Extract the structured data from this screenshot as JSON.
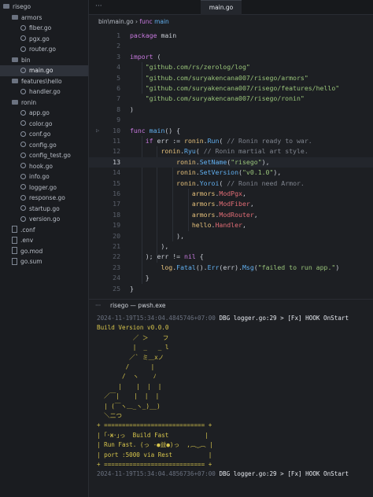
{
  "sidebar": {
    "items": [
      {
        "label": "risego",
        "type": "folder",
        "depth": 0
      },
      {
        "label": "armors",
        "type": "folder",
        "depth": 1
      },
      {
        "label": "fiber.go",
        "type": "file",
        "depth": 2
      },
      {
        "label": "pgx.go",
        "type": "file",
        "depth": 2
      },
      {
        "label": "router.go",
        "type": "file",
        "depth": 2
      },
      {
        "label": "bin",
        "type": "folder",
        "depth": 1
      },
      {
        "label": "main.go",
        "type": "file",
        "depth": 2,
        "selected": true
      },
      {
        "label": "features\\hello",
        "type": "folder",
        "depth": 1
      },
      {
        "label": "handler.go",
        "type": "file",
        "depth": 2
      },
      {
        "label": "ronin",
        "type": "folder",
        "depth": 1
      },
      {
        "label": "app.go",
        "type": "file",
        "depth": 2
      },
      {
        "label": "color.go",
        "type": "file",
        "depth": 2
      },
      {
        "label": "conf.go",
        "type": "file",
        "depth": 2
      },
      {
        "label": "config.go",
        "type": "file",
        "depth": 2
      },
      {
        "label": "config_test.go",
        "type": "file",
        "depth": 2
      },
      {
        "label": "hook.go",
        "type": "file",
        "depth": 2
      },
      {
        "label": "info.go",
        "type": "file",
        "depth": 2
      },
      {
        "label": "logger.go",
        "type": "file",
        "depth": 2
      },
      {
        "label": "response.go",
        "type": "file",
        "depth": 2
      },
      {
        "label": "startup.go",
        "type": "file",
        "depth": 2
      },
      {
        "label": "version.go",
        "type": "file",
        "depth": 2
      },
      {
        "label": ".conf",
        "type": "file",
        "depth": 1
      },
      {
        "label": ".env",
        "type": "file",
        "depth": 1
      },
      {
        "label": "go.mod",
        "type": "file",
        "depth": 1
      },
      {
        "label": "go.sum",
        "type": "file",
        "depth": 1
      }
    ]
  },
  "tabbar": {
    "ellipsis": "···",
    "active_tab": "main.go"
  },
  "breadcrumb": {
    "path": "bin\\main.go",
    "sep": "›",
    "func_kw": "func",
    "func_name": "main"
  },
  "editor": {
    "current_line": 13,
    "lines": [
      {
        "n": "1",
        "tokens": [
          [
            "kw",
            "package"
          ],
          [
            "punc",
            " main"
          ]
        ]
      },
      {
        "n": "2",
        "tokens": []
      },
      {
        "n": "3",
        "tokens": [
          [
            "kw",
            "import"
          ],
          [
            "punc",
            " ("
          ]
        ]
      },
      {
        "n": "4",
        "tokens": [
          [
            "punc",
            "    "
          ],
          [
            "str",
            "\"github.com/rs/zerolog/log\""
          ]
        ]
      },
      {
        "n": "5",
        "tokens": [
          [
            "punc",
            "    "
          ],
          [
            "str",
            "\"github.com/suryakencana007/risego/armors\""
          ]
        ]
      },
      {
        "n": "6",
        "tokens": [
          [
            "punc",
            "    "
          ],
          [
            "str",
            "\"github.com/suryakencana007/risego/features/hello\""
          ]
        ]
      },
      {
        "n": "7",
        "tokens": [
          [
            "punc",
            "    "
          ],
          [
            "str",
            "\"github.com/suryakencana007/risego/ronin\""
          ]
        ]
      },
      {
        "n": "8",
        "tokens": [
          [
            "punc",
            ")"
          ]
        ]
      },
      {
        "n": "9",
        "tokens": []
      },
      {
        "n": "10",
        "fold": true,
        "tokens": [
          [
            "kw",
            "func"
          ],
          [
            "punc",
            " "
          ],
          [
            "fn",
            "main"
          ],
          [
            "punc",
            "() {"
          ]
        ]
      },
      {
        "n": "11",
        "tokens": [
          [
            "punc",
            "    "
          ],
          [
            "kw",
            "if"
          ],
          [
            "punc",
            " err := "
          ],
          [
            "var",
            "ronin"
          ],
          [
            "punc",
            "."
          ],
          [
            "fn",
            "Run"
          ],
          [
            "punc",
            "( "
          ],
          [
            "cmt",
            "// Ronin ready to war."
          ]
        ]
      },
      {
        "n": "12",
        "tokens": [
          [
            "punc",
            "        "
          ],
          [
            "var",
            "ronin"
          ],
          [
            "punc",
            "."
          ],
          [
            "fn",
            "Ryu"
          ],
          [
            "punc",
            "( "
          ],
          [
            "cmt",
            "// Ronin martial art style."
          ]
        ]
      },
      {
        "n": "13",
        "tokens": [
          [
            "punc",
            "            "
          ],
          [
            "var",
            "ronin"
          ],
          [
            "punc",
            "."
          ],
          [
            "fn",
            "SetName"
          ],
          [
            "punc",
            "("
          ],
          [
            "str",
            "\"risego\""
          ],
          [
            "punc",
            "),"
          ]
        ]
      },
      {
        "n": "14",
        "tokens": [
          [
            "punc",
            "            "
          ],
          [
            "var",
            "ronin"
          ],
          [
            "punc",
            "."
          ],
          [
            "fn",
            "SetVersion"
          ],
          [
            "punc",
            "("
          ],
          [
            "str",
            "\"v0.1.0\""
          ],
          [
            "punc",
            "),"
          ]
        ]
      },
      {
        "n": "15",
        "tokens": [
          [
            "punc",
            "            "
          ],
          [
            "var",
            "ronin"
          ],
          [
            "punc",
            "."
          ],
          [
            "fn",
            "Yoroi"
          ],
          [
            "punc",
            "( "
          ],
          [
            "cmt",
            "// Ronin need Armor."
          ]
        ]
      },
      {
        "n": "16",
        "tokens": [
          [
            "punc",
            "                "
          ],
          [
            "var",
            "armors"
          ],
          [
            "punc",
            "."
          ],
          [
            "fld",
            "ModPgx"
          ],
          [
            "punc",
            ","
          ]
        ]
      },
      {
        "n": "17",
        "tokens": [
          [
            "punc",
            "                "
          ],
          [
            "var",
            "armors"
          ],
          [
            "punc",
            "."
          ],
          [
            "fld",
            "ModFiber"
          ],
          [
            "punc",
            ","
          ]
        ]
      },
      {
        "n": "18",
        "tokens": [
          [
            "punc",
            "                "
          ],
          [
            "var",
            "armors"
          ],
          [
            "punc",
            "."
          ],
          [
            "fld",
            "ModRouter"
          ],
          [
            "punc",
            ","
          ]
        ]
      },
      {
        "n": "19",
        "tokens": [
          [
            "punc",
            "                "
          ],
          [
            "var",
            "hello"
          ],
          [
            "punc",
            "."
          ],
          [
            "fld",
            "Handler"
          ],
          [
            "punc",
            ","
          ]
        ]
      },
      {
        "n": "20",
        "tokens": [
          [
            "punc",
            "            ),"
          ]
        ]
      },
      {
        "n": "21",
        "tokens": [
          [
            "punc",
            "        ),"
          ]
        ]
      },
      {
        "n": "22",
        "tokens": [
          [
            "punc",
            "    ); err != "
          ],
          [
            "kw",
            "nil"
          ],
          [
            "punc",
            " {"
          ]
        ]
      },
      {
        "n": "23",
        "tokens": [
          [
            "punc",
            "        "
          ],
          [
            "var",
            "log"
          ],
          [
            "punc",
            "."
          ],
          [
            "fn",
            "Fatal"
          ],
          [
            "punc",
            "()."
          ],
          [
            "fn",
            "Err"
          ],
          [
            "punc",
            "(err)."
          ],
          [
            "fn",
            "Msg"
          ],
          [
            "punc",
            "("
          ],
          [
            "str",
            "\"failed to run app.\""
          ],
          [
            "punc",
            ")"
          ]
        ]
      },
      {
        "n": "24",
        "tokens": [
          [
            "punc",
            "    }"
          ]
        ]
      },
      {
        "n": "25",
        "tokens": [
          [
            "punc",
            "}"
          ]
        ]
      }
    ]
  },
  "terminal": {
    "ellipsis": "···",
    "title": "risego — pwsh.exe",
    "lines": [
      {
        "cls": "dim",
        "text": "2024-11-19T15:34:04.4845746+07:00 ",
        "rest": "DBG logger.go:29 > [Fx] HOOK OnStart"
      },
      {
        "cls": "yellow",
        "text": "Build Version v0.0.0"
      },
      {
        "cls": "yellow",
        "text": "          ／ ＞    フ"
      },
      {
        "cls": "yellow",
        "text": "          |  _   _ l"
      },
      {
        "cls": "yellow",
        "text": "         ／` ミ＿xノ"
      },
      {
        "cls": "yellow",
        "text": "        /      |"
      },
      {
        "cls": "yellow",
        "text": "       /  ヽ    ﾉ"
      },
      {
        "cls": "yellow",
        "text": "      |    |  |  |"
      },
      {
        "cls": "yellow",
        "text": "  ／￣|    |  |  |"
      },
      {
        "cls": "yellow",
        "text": "  | (￣ヽ＿_ヽ_)__)"
      },
      {
        "cls": "yellow",
        "text": "  ＼二つ"
      },
      {
        "cls": "yellow",
        "text": "+ ============================ +"
      },
      {
        "cls": "yellow",
        "text": "| ｢･ж･｣っ  Build Fast          |"
      },
      {
        "cls": "yellow",
        "text": "| Run Fast. (っ -●益●)っ  ,︵‿︵ |"
      },
      {
        "cls": "yellow",
        "text": "| port :5000 via Rest          |"
      },
      {
        "cls": "yellow",
        "text": "+ ============================ +"
      },
      {
        "cls": "dim",
        "text": "2024-11-19T15:34:04.4856736+07:00 ",
        "rest": "DBG logger.go:29 > [Fx] HOOK OnStart"
      }
    ]
  }
}
